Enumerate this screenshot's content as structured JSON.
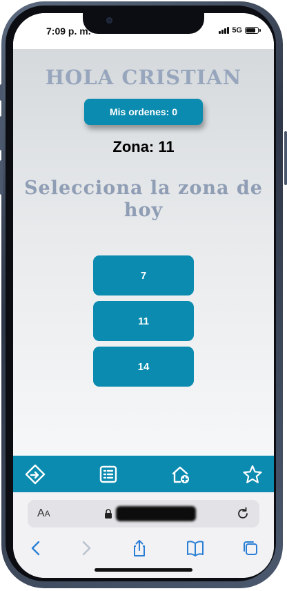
{
  "status_bar": {
    "time": "7:09 p. m.",
    "network": "5G",
    "icons": [
      "signal-icon",
      "battery-icon"
    ]
  },
  "page": {
    "greeting": "HOLA CRISTIAN",
    "orders_button": "Mis ordenes: 0",
    "zone_label": "Zona: 11",
    "select_heading": "Selecciona la zona de hoy",
    "zone_options": [
      "7",
      "11",
      "14"
    ]
  },
  "tab_bar": {
    "icons": [
      "directions-icon",
      "list-icon",
      "add-home-icon",
      "star-icon"
    ]
  },
  "browser": {
    "text_size_label": "A",
    "text_size_label_small": "A",
    "icons": [
      "lock-icon",
      "reload-icon",
      "back-icon",
      "forward-icon",
      "share-icon",
      "bookmarks-icon",
      "tabs-icon"
    ]
  },
  "colors": {
    "accent": "#0b8bb0",
    "heading_text": "#97a6bd",
    "background_top": "#d5d9dc",
    "background_bottom": "#f6f7f8"
  }
}
